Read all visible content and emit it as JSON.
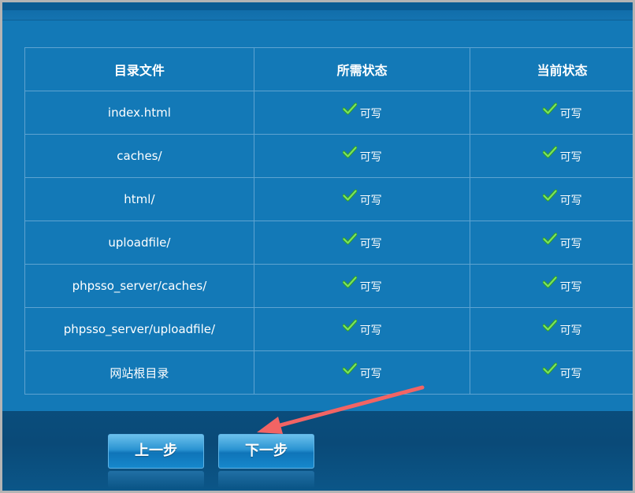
{
  "table": {
    "headers": [
      "目录文件",
      "所需状态",
      "当前状态"
    ],
    "rows": [
      {
        "name": "index.html",
        "required": "可写",
        "current": "可写"
      },
      {
        "name": "caches/",
        "required": "可写",
        "current": "可写"
      },
      {
        "name": "html/",
        "required": "可写",
        "current": "可写"
      },
      {
        "name": "uploadfile/",
        "required": "可写",
        "current": "可写"
      },
      {
        "name": "phpsso_server/caches/",
        "required": "可写",
        "current": "可写"
      },
      {
        "name": "phpsso_server/uploadfile/",
        "required": "可写",
        "current": "可写"
      },
      {
        "name": "网站根目录",
        "required": "可写",
        "current": "可写"
      }
    ]
  },
  "buttons": {
    "prev_label": "上一步",
    "next_label": "下一步"
  },
  "icons": {
    "status_ok": "check-icon"
  },
  "colors": {
    "panel_bg": "#1379b7",
    "table_border": "#5ea3d1",
    "check_green": "#63d64a",
    "annotation_arrow": "#f26464",
    "footer_bg": "#0a4d7c"
  }
}
